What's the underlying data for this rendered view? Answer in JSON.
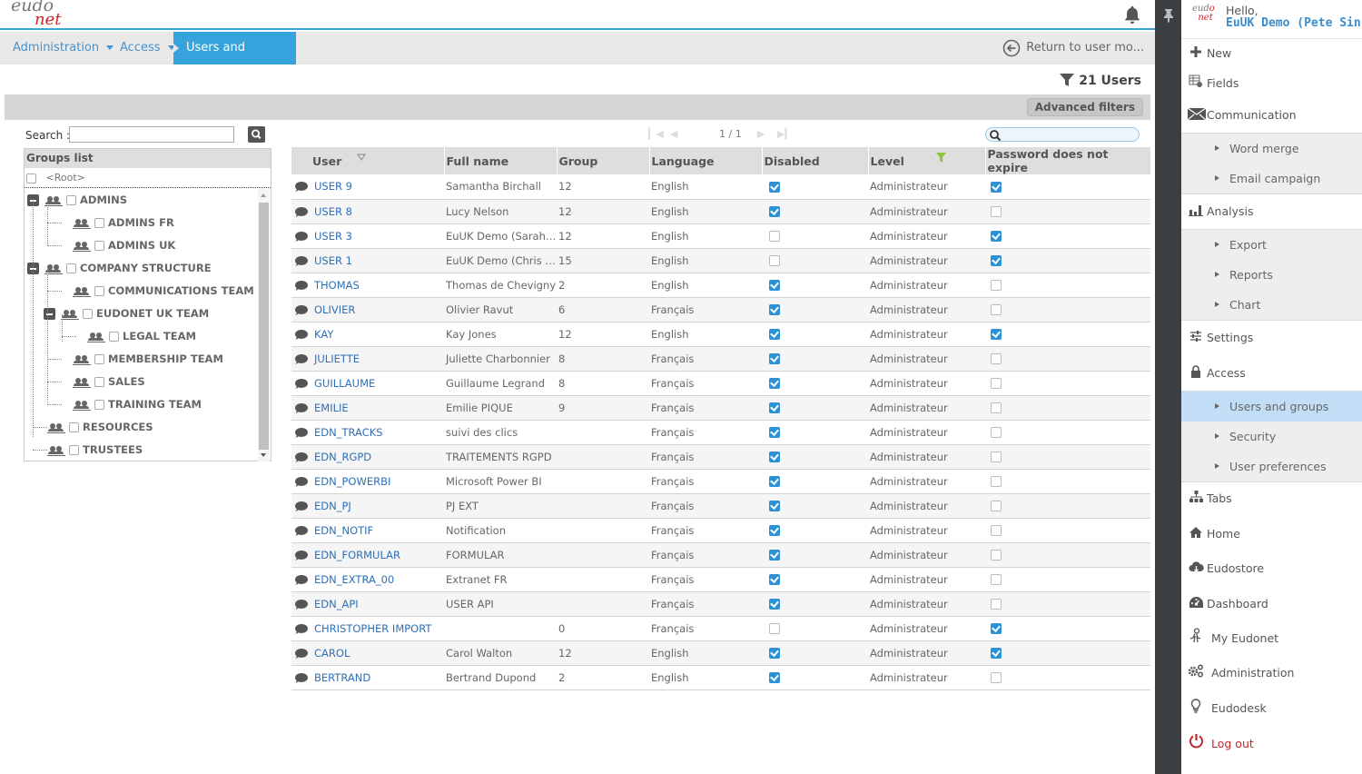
{
  "app": {
    "logo_text_top": "eudo",
    "logo_text_bottom": "net"
  },
  "breadcrumb": [
    {
      "label": "Administration",
      "has_dropdown": true
    },
    {
      "label": "Access",
      "has_dropdown": true
    },
    {
      "label": "Users and groups",
      "active": true
    }
  ],
  "return_label": "Return to user mo...",
  "user_count_label": "21 Users",
  "advanced_filters_label": "Advanced filters",
  "search": {
    "label": "Search :",
    "value": "",
    "placeholder": ""
  },
  "groups": {
    "title": "Groups list",
    "root_label": "<Root>",
    "nodes": [
      {
        "label": "ADMINS",
        "level": 0,
        "expanded": true
      },
      {
        "label": "ADMINS FR",
        "level": 1
      },
      {
        "label": "ADMINS UK",
        "level": 1
      },
      {
        "label": "COMPANY STRUCTURE",
        "level": 0,
        "expanded": true
      },
      {
        "label": "COMMUNICATIONS TEAM",
        "level": 1
      },
      {
        "label": "EUDONET UK TEAM",
        "level": 1,
        "expanded": true
      },
      {
        "label": "LEGAL TEAM",
        "level": 2
      },
      {
        "label": "MEMBERSHIP TEAM",
        "level": 1
      },
      {
        "label": "SALES",
        "level": 1
      },
      {
        "label": "TRAINING TEAM",
        "level": 1
      },
      {
        "label": "RESOURCES",
        "level": 0
      },
      {
        "label": "TRUSTEES",
        "level": 0
      }
    ]
  },
  "pager": {
    "label": "1 / 1"
  },
  "quick_search": {
    "value": "",
    "placeholder": ""
  },
  "table": {
    "columns": [
      "User",
      "Full name",
      "Group",
      "Language",
      "Disabled",
      "Level",
      "Password does not expire"
    ],
    "rows": [
      {
        "user": "USER 9",
        "full_name": "Samantha Birchall",
        "group": "12",
        "language": "English",
        "disabled": true,
        "level": "Administrateur",
        "pwd_no_expire": true
      },
      {
        "user": "USER 8",
        "full_name": "Lucy Nelson",
        "group": "12",
        "language": "English",
        "disabled": true,
        "level": "Administrateur",
        "pwd_no_expire": false
      },
      {
        "user": "USER 3",
        "full_name": "EuUK Demo (Sarah ...",
        "group": "12",
        "language": "English",
        "disabled": false,
        "level": "Administrateur",
        "pwd_no_expire": true
      },
      {
        "user": "USER 1",
        "full_name": "EuUK Demo (Chris S...",
        "group": "15",
        "language": "English",
        "disabled": false,
        "level": "Administrateur",
        "pwd_no_expire": true
      },
      {
        "user": "THOMAS",
        "full_name": "Thomas de Chevigny",
        "group": "2",
        "language": "English",
        "disabled": true,
        "level": "Administrateur",
        "pwd_no_expire": false
      },
      {
        "user": "OLIVIER",
        "full_name": "Olivier Ravut",
        "group": "6",
        "language": "Français",
        "disabled": true,
        "level": "Administrateur",
        "pwd_no_expire": false
      },
      {
        "user": "KAY",
        "full_name": "Kay Jones",
        "group": "12",
        "language": "English",
        "disabled": true,
        "level": "Administrateur",
        "pwd_no_expire": true
      },
      {
        "user": "JULIETTE",
        "full_name": "Juliette Charbonnier",
        "group": "8",
        "language": "Français",
        "disabled": true,
        "level": "Administrateur",
        "pwd_no_expire": false
      },
      {
        "user": "GUILLAUME",
        "full_name": "Guillaume Legrand",
        "group": "8",
        "language": "Français",
        "disabled": true,
        "level": "Administrateur",
        "pwd_no_expire": false
      },
      {
        "user": "EMILIE",
        "full_name": "Emilie PIQUE",
        "group": "9",
        "language": "Français",
        "disabled": true,
        "level": "Administrateur",
        "pwd_no_expire": false
      },
      {
        "user": "EDN_TRACKS",
        "full_name": "suivi des clics",
        "group": "",
        "language": "Français",
        "disabled": true,
        "level": "Administrateur",
        "pwd_no_expire": false
      },
      {
        "user": "EDN_RGPD",
        "full_name": "TRAITEMENTS RGPD",
        "group": "",
        "language": "Français",
        "disabled": true,
        "level": "Administrateur",
        "pwd_no_expire": false
      },
      {
        "user": "EDN_POWERBI",
        "full_name": "Microsoft Power BI",
        "group": "",
        "language": "Français",
        "disabled": true,
        "level": "Administrateur",
        "pwd_no_expire": false
      },
      {
        "user": "EDN_PJ",
        "full_name": "PJ EXT",
        "group": "",
        "language": "Français",
        "disabled": true,
        "level": "Administrateur",
        "pwd_no_expire": false
      },
      {
        "user": "EDN_NOTIF",
        "full_name": "Notification",
        "group": "",
        "language": "Français",
        "disabled": true,
        "level": "Administrateur",
        "pwd_no_expire": false
      },
      {
        "user": "EDN_FORMULAR",
        "full_name": "FORMULAR",
        "group": "",
        "language": "Français",
        "disabled": true,
        "level": "Administrateur",
        "pwd_no_expire": false
      },
      {
        "user": "EDN_EXTRA_00",
        "full_name": "Extranet FR",
        "group": "",
        "language": "Français",
        "disabled": true,
        "level": "Administrateur",
        "pwd_no_expire": false
      },
      {
        "user": "EDN_API",
        "full_name": "USER API",
        "group": "",
        "language": "Français",
        "disabled": true,
        "level": "Administrateur",
        "pwd_no_expire": false
      },
      {
        "user": "CHRISTOPHER IMPORT",
        "full_name": "",
        "group": "0",
        "language": "Français",
        "disabled": false,
        "level": "Administrateur",
        "pwd_no_expire": true
      },
      {
        "user": "CAROL",
        "full_name": "Carol Walton",
        "group": "12",
        "language": "English",
        "disabled": true,
        "level": "Administrateur",
        "pwd_no_expire": true
      },
      {
        "user": "BERTRAND",
        "full_name": "Bertrand Dupond",
        "group": "2",
        "language": "English",
        "disabled": true,
        "level": "Administrateur",
        "pwd_no_expire": false
      }
    ]
  },
  "side": {
    "greeting": "Hello,",
    "user_name": "EuUK Demo (Pete Sinclair)",
    "items": [
      {
        "label": "New",
        "icon": "plus-icon"
      },
      {
        "label": "Fields",
        "icon": "fields-icon"
      },
      {
        "label": "Communication",
        "icon": "envelope-icon",
        "children": [
          "Word merge",
          "Email campaign"
        ]
      },
      {
        "label": "Analysis",
        "icon": "bar-chart-icon",
        "children": [
          "Export",
          "Reports",
          "Chart"
        ]
      },
      {
        "label": "Settings",
        "icon": "sliders-icon"
      },
      {
        "label": "Access",
        "icon": "lock-icon",
        "children": [
          "Users and groups",
          "Security",
          "User preferences"
        ],
        "active_child": "Users and groups"
      },
      {
        "label": "Tabs",
        "icon": "sitemap-icon"
      },
      {
        "label": "Home",
        "icon": "home-icon"
      },
      {
        "label": "Eudostore",
        "icon": "cloud-icon"
      },
      {
        "label": "Dashboard",
        "icon": "dashboard-icon"
      },
      {
        "label": "My Eudonet",
        "icon": "person-icon"
      },
      {
        "label": "Administration",
        "icon": "gears-icon"
      },
      {
        "label": "Eudodesk",
        "icon": "lightbulb-icon"
      },
      {
        "label": "Log out",
        "icon": "power-icon"
      }
    ]
  },
  "colors": {
    "accent": "#36a3dc",
    "link": "#2e6fb6",
    "checkbox_on": "#2d91d6",
    "logout": "#c0262d",
    "active_submenu": "#c2def6"
  }
}
